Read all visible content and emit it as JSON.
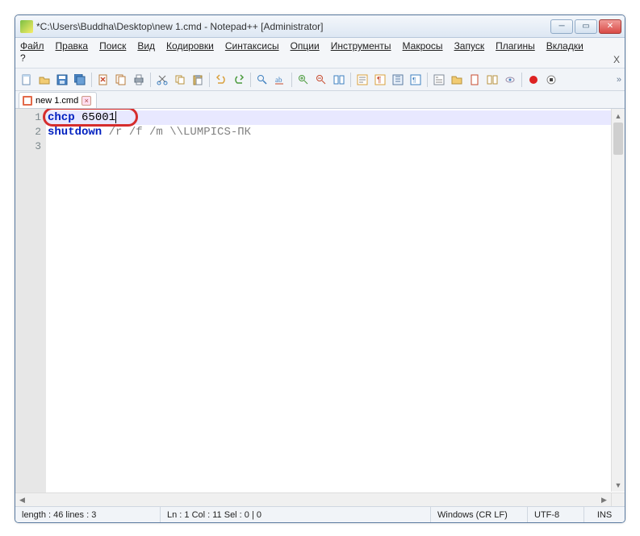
{
  "title": "*C:\\Users\\Buddha\\Desktop\\new 1.cmd - Notepad++ [Administrator]",
  "menu": {
    "file": "Файл",
    "edit": "Правка",
    "search": "Поиск",
    "view": "Вид",
    "encoding": "Кодировки",
    "syntax": "Синтаксисы",
    "options": "Опции",
    "tools": "Инструменты",
    "macros": "Макросы",
    "run": "Запуск",
    "plugins": "Плагины",
    "tabs": "Вкладки",
    "help": "?"
  },
  "tab": {
    "name": "new 1.cmd"
  },
  "code": {
    "lines": [
      {
        "n": "1",
        "kw": "chcp",
        "rest": " 65001"
      },
      {
        "n": "2",
        "kw": "shutdown",
        "rest": " /r /f /m \\\\LUMPICS-ПК"
      },
      {
        "n": "3",
        "kw": "",
        "rest": ""
      }
    ]
  },
  "status": {
    "length": "length : 46    lines : 3",
    "pos": "Ln : 1    Col : 11    Sel : 0 | 0",
    "eol": "Windows (CR LF)",
    "enc": "UTF-8",
    "ovr": "INS"
  },
  "icons": {
    "new": "new-icon",
    "open": "open-icon",
    "save": "save-icon",
    "saveall": "saveall-icon",
    "close": "close-icon",
    "closeall": "closeall-icon",
    "print": "print-icon",
    "cut": "cut-icon",
    "copy": "copy-icon",
    "paste": "paste-icon",
    "undo": "undo-icon",
    "redo": "redo-icon",
    "find": "find-icon",
    "replace": "replace-icon",
    "zoomin": "zoomin-icon",
    "zoomout": "zoomout-icon",
    "sync": "sync-icon",
    "wrap": "wrap-icon",
    "ws": "whitespace-icon",
    "indent": "indent-icon",
    "fn": "function-icon",
    "folder": "folder-icon",
    "doc": "doc-icon",
    "monitor": "monitor-icon",
    "rec": "record-icon",
    "play": "play-icon",
    "rec2": "record2-icon",
    "stop": "stop-icon"
  }
}
